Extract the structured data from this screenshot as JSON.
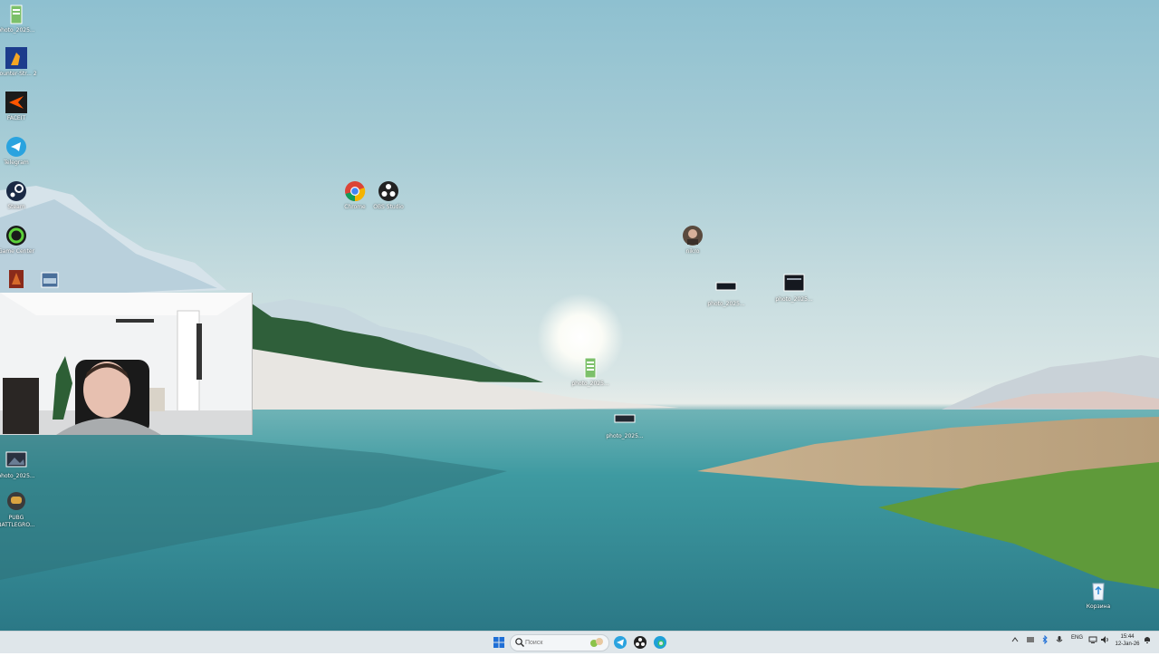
{
  "desktop_icons": [
    {
      "name": "photo-file-icon",
      "label": "photo_2025..."
    },
    {
      "name": "counter-strike-icon",
      "label": "Counter-Str... 2"
    },
    {
      "name": "faceit-icon",
      "label": "FACEIT"
    },
    {
      "name": "telegram-icon",
      "label": "Telegram"
    },
    {
      "name": "steam-icon",
      "label": "Steam"
    },
    {
      "name": "game-center-icon",
      "label": "Game Center"
    },
    {
      "name": "chrome-icon",
      "label": "Chrome"
    },
    {
      "name": "obs-studio-icon",
      "label": "OBS Studio"
    },
    {
      "name": "avatar-file-icon",
      "label": "nikro"
    },
    {
      "name": "photo-screenshot-icon",
      "label": "photo_2025..."
    },
    {
      "name": "photo-dark-icon",
      "label": "photo_2025..."
    },
    {
      "name": "photo-doc-icon",
      "label": "photo_2025..."
    },
    {
      "name": "photo-strip-icon",
      "label": "photo_2025..."
    },
    {
      "name": "photo-bottom-left-icon",
      "label": "photo_2025..."
    },
    {
      "name": "pubg-icon",
      "label": "PUBG BATTLEGRO..."
    },
    {
      "name": "recycle-bin-icon",
      "label": "Корзина"
    }
  ],
  "taskbar": {
    "search_placeholder": "Поиск",
    "language": "ENG",
    "time": "15:44",
    "date": "12-Jan-26"
  },
  "colors": {
    "taskbar_bg": "#dfe6ea",
    "windows_blue": "#1f6fd6",
    "telegram": "#2aa3df"
  }
}
